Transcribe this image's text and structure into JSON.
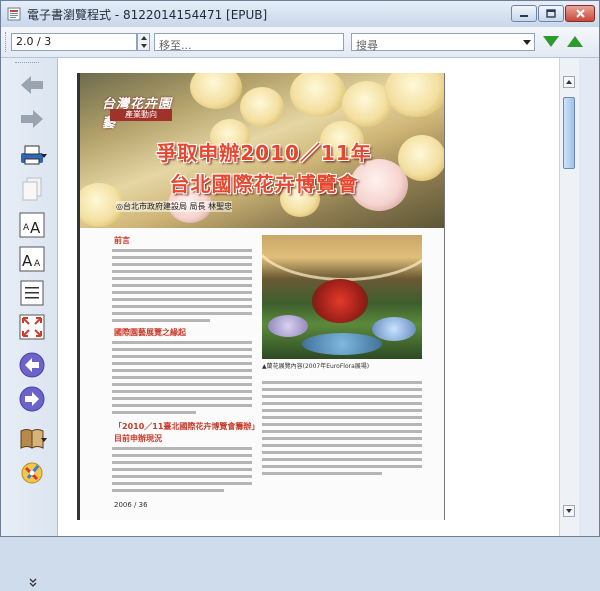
{
  "window": {
    "title": "電子書瀏覽程式 - 8122014154471 [EPUB]"
  },
  "toolbar": {
    "page_value": "2.0 / 3",
    "goto_placeholder": "移至...",
    "search_placeholder": "搜尋"
  },
  "document": {
    "logo_script": "台灣花卉園藝",
    "logo_tag": "產業動向",
    "headline_line1": "爭取申辦2010／11年",
    "headline_line2": "台北國際花卉博覽會",
    "byline": "◎台北市政府建設局 局長 林聖忠",
    "section1_title": "前言",
    "section2_title": "國際園藝展覽之緣起",
    "section3_title": "「2010／11臺北國際花卉博覽會籌辦」",
    "section3_sub": "目前申辦現況",
    "photo_caption": "▲蘭花展覽內容(2007年EuroFlora展場)",
    "page_number": "2006 / 36"
  },
  "icons": {
    "back": "back-arrow-icon",
    "forward": "forward-arrow-icon",
    "print": "printer-icon",
    "copy": "copy-page-icon",
    "font_larger": "font-increase-icon",
    "font_smaller": "font-decrease-icon",
    "page_layout": "page-layout-icon",
    "fit": "fit-to-window-icon",
    "prev": "previous-page-icon",
    "next": "next-page-icon",
    "library": "library-books-icon",
    "tools": "tools-icon"
  },
  "colors": {
    "nav_green": "#2e9a2e",
    "accent_purple": "#6b63c9",
    "headline_red": "#e8472f"
  }
}
